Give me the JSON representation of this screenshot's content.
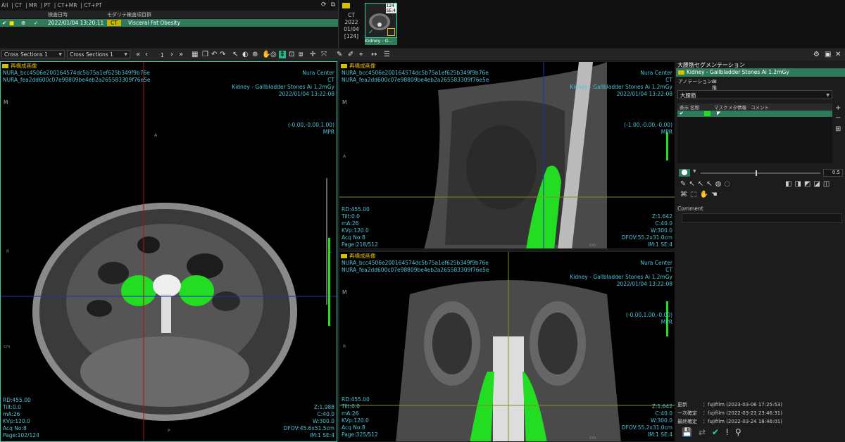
{
  "study_list": {
    "tabs": [
      "All",
      "CT",
      "MR",
      "PT",
      "CT+MR",
      "CT+PT"
    ],
    "header": {
      "date": "検査日時",
      "modality": "モダリティ",
      "group": "検査項目群"
    },
    "row": {
      "date": "2022/01/04 13:20:11",
      "modality": "CT",
      "group": "Visceral Fat Obesity"
    }
  },
  "thumbnail": {
    "modality": "CT",
    "year": "2022",
    "date": "01/04",
    "count": "[124]",
    "badge_top": "124",
    "badge_bottom": "SE:4",
    "caption": "Kidney - G..."
  },
  "toolbar": {
    "layout_left": "Cross Sections 1",
    "layout_right": "Cross Sections 1",
    "page_index": "1"
  },
  "viewports": {
    "axial": {
      "header": "再構成画像",
      "uid1": "NURA_bcc4506e200164574dc5b75a1ef625b349f9b76e",
      "uid2": "NURA_fea2dd600c07e98809be4eb2a265583309f76e5e",
      "institution": "Nura Center",
      "modality": "CT",
      "series": "Kidney - Gallbladder Stones Ai 1.2mGy",
      "datetime": "2022/01/04 13:22:08",
      "orient_top": "M",
      "coords": "(-0.00,-0.00,1.00)",
      "mode": "MPR",
      "left_info": [
        "RD:455.00",
        "Tilt:0.0",
        "mA:26",
        "KVp:120.0",
        "Acq No:8",
        "Page:102/124"
      ],
      "right_info": [
        "Z:1.988",
        "C:40.0",
        "W:300.0",
        "DFOV:45.6x51.5cm",
        "IM:1 SE:4"
      ],
      "side_r": "R",
      "side_l": "L",
      "side_a": "A",
      "side_p": "P",
      "cm": "cm"
    },
    "sagittal": {
      "header": "再構成画像",
      "uid1": "NURA_bcc4506e200164574dc5b75a1ef625b349f9b76e",
      "uid2": "NURA_fea2dd600c07e98809be4eb2a265583309f76e5e",
      "institution": "Nura Center",
      "modality": "CT",
      "series": "Kidney - Gallbladder Stones Ai 1.2mGy",
      "datetime": "2022/01/04 13:22:08",
      "orient_top": "M",
      "coords": "(-1.00,-0.00,-0.00)",
      "mode": "MPR",
      "left_info": [
        "RD:455.00",
        "Tilt:0.0",
        "mA:26",
        "KVp:120.0",
        "Acq No:8",
        "Page:218/512"
      ],
      "right_info": [
        "Z:1.642",
        "C:40.0",
        "W:300.0",
        "DFOV:55.2x31.0cm",
        "IM:1 SE:4"
      ],
      "side_a": "A",
      "cm": "cm"
    },
    "coronal": {
      "header": "再構成画像",
      "uid1": "NURA_bcc4506e200164574dc5b75a1ef625b349f9b76e",
      "uid2": "NURA_fea2dd600c07e98809be4eb2a265583309f76e5e",
      "institution": "Nura Center",
      "modality": "CT",
      "series": "Kidney - Gallbladder Stones Ai 1.2mGy",
      "datetime": "2022/01/04 13:22:08",
      "orient_top": "M",
      "coords": "(-0.00,1.00,-0.00)",
      "mode": "MPR",
      "left_info": [
        "RD:455.00",
        "Tilt:0.0",
        "mA:26",
        "KVp:120.0",
        "Acq No:8",
        "Page:325/512"
      ],
      "right_info": [
        "Z:1.642",
        "C:40.0",
        "W:300.0",
        "DFOV:55.2x31.0cm",
        "IM:1 SE:4"
      ],
      "side_r": "R",
      "cm": "cm"
    }
  },
  "panel": {
    "title": "大腰筋セグメンテーション",
    "subtitle": "Kidney - Gallbladder Stones Ai 1.2mGy",
    "tab_annotation": "アノテーション",
    "tab_ai": "AI推定",
    "muscle_select": "大腰筋",
    "grid_headers": {
      "show": "表示",
      "name": "名称",
      "mask": "マスク",
      "meta": "メタ情報",
      "comment": "コメント"
    },
    "opacity_value": "0.5",
    "comment_label": "Comment",
    "history": [
      {
        "label": "更新",
        "value": "：fujifilm (2023-03-06 17:25:53)"
      },
      {
        "label": "一次確定",
        "value": "：fujifilm (2022-03-23 23:46:31)"
      },
      {
        "label": "最終確定",
        "value": "：fujifilm (2022-03-24 18:46:01)"
      }
    ]
  },
  "colors": {
    "accent": "#2f7a5a",
    "mask": "#22dd22",
    "overlay_text": "#4fc3d6",
    "header_yellow": "#e8c000"
  }
}
